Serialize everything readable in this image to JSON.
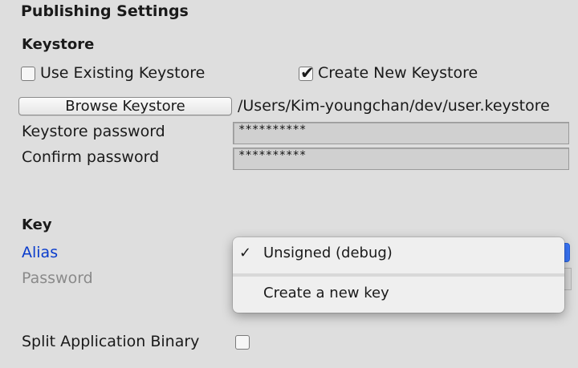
{
  "header": {
    "title": "Publishing Settings"
  },
  "keystore": {
    "section_title": "Keystore",
    "use_existing_label": "Use Existing Keystore",
    "use_existing_checked": false,
    "create_new_label": "Create New Keystore",
    "create_new_checked": true,
    "browse_button_label": "Browse Keystore",
    "path": "/Users/Kim-youngchan/dev/user.keystore",
    "password_label": "Keystore password",
    "password_value": "**********",
    "confirm_label": "Confirm password",
    "confirm_value": "**********"
  },
  "key": {
    "section_title": "Key",
    "alias_label": "Alias",
    "password_label": "Password"
  },
  "alias_menu": {
    "items": [
      {
        "label": "Unsigned (debug)",
        "selected": true,
        "check_glyph": "✓"
      },
      {
        "label": "Create a new key",
        "selected": false
      }
    ]
  },
  "split_binary": {
    "label": "Split Application Binary",
    "checked": false
  },
  "colors": {
    "background": "#dedede",
    "alias_label": "#0a3ccc",
    "accent": "#3a78ff"
  }
}
